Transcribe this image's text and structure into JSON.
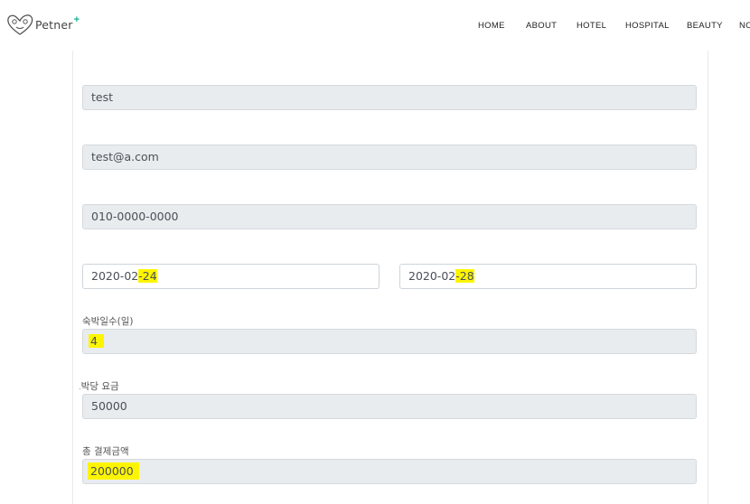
{
  "nav": {
    "brand": "Petner",
    "brand_plus": "+",
    "items": [
      "HOME",
      "ABOUT",
      "HOTEL",
      "HOSPITAL",
      "BEAUTY",
      "NO"
    ]
  },
  "form": {
    "name_value": "test",
    "email_value": "test@a.com",
    "phone_value": "010-0000-0000",
    "checkin_prefix": "2020-02",
    "checkin_day": "-24",
    "checkout_prefix": "2020-02",
    "checkout_day": "-28",
    "nights_label": "숙박일수(일)",
    "nights_value": "4",
    "price_label": "1박당 요금",
    "price_value": "50000",
    "total_label": "총 결제금액",
    "total_value": "200000"
  },
  "colors": {
    "highlight": "#fdf500",
    "brand_accent": "#1ab394",
    "readonly_bg": "#e9ecef"
  }
}
